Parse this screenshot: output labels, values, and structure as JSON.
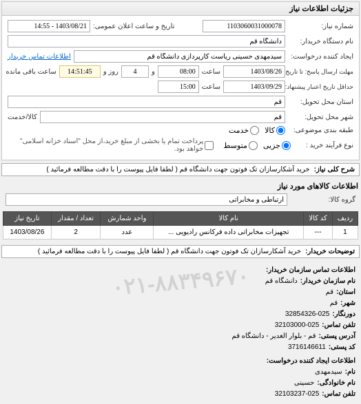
{
  "panel_title": "جزئیات اطلاعات نیاز",
  "fields": {
    "number_label": "شماره نیاز:",
    "number_value": "1103060031000078",
    "announce_label": "تاریخ و ساعت اعلان عمومی:",
    "announce_value": "1403/08/21 - 14:55",
    "device_label": "نام دستگاه خریدار:",
    "device_value": "دانشگاه قم",
    "requester_label": "ایجاد کننده درخواست:",
    "requester_value": "سیدمهدی حسینی ریاست کارپردازی دانشگاه قم",
    "contact_link": "اطلاعات تماس خریدار",
    "response_until_label": "مهلت ارسال پاسخ: تا تاریخ:",
    "response_date": "1403/08/26",
    "response_time_label": "ساعت",
    "response_time": "08:00",
    "and_label": "و",
    "remaining_days": "4",
    "remaining_days_label": "روز و",
    "remaining_time": "14:51:45",
    "remaining_suffix": "ساعت باقی مانده",
    "validity_label": "حداقل تاریخ اعتبار پیشنهاد: تا تاریخ:",
    "validity_date": "1403/09/29",
    "validity_time_label": "ساعت",
    "validity_time": "15:00",
    "province_label": "استان محل تحویل:",
    "province_value": "قم",
    "city_label": "شهر محل تحویل:",
    "city_value": "قم",
    "service_label": "کالا/خدمت",
    "radio_category_label": "طبقه بندی موضوعی:",
    "radio_goods": "کالا",
    "radio_service": "خدمت",
    "radio_type_label": "نوع فرآیند خرید :",
    "radio_partial": "جزیی",
    "radio_medium": "متوسط",
    "payment_note": "پرداخت تمام یا بخشی از مبلغ خرید،از محل \"اسناد خزانه اسلامی\" خواهد بود."
  },
  "description": {
    "label": "شرح کلی نیاز:",
    "value": "خرید آشکارسازان تک فوتون جهت دانشگاه قم ( لطفا فایل پیوست را با دقت مطالعه فرمائید )"
  },
  "goods_section_title": "اطلاعات کالاهای مورد نیاز",
  "group_label": "گروه کالا:",
  "group_value": "ارتباطی و مخابراتی",
  "table": {
    "headers": [
      "ردیف",
      "کد کالا",
      "نام کالا",
      "واحد شمارش",
      "تعداد / مقدار",
      "تاریخ نیاز"
    ],
    "rows": [
      [
        "1",
        "---",
        "تجهیزات مخابراتی داده فرکانس رادیویی ...",
        "عدد",
        "2",
        "1403/08/26"
      ]
    ]
  },
  "buyer_notes": {
    "label": "توضیحات خریدار:",
    "value": "خرید آشکارسازان تک فوتون جهت دانشگاه قم ( لطفا فایل پیوست را با دقت مطالعه فرمائید )"
  },
  "watermark_text": "۰۲۱-۸۸۳۴۹۶۷۰",
  "contact_section_title": "اطلاعات تماس سازمان خریدار:",
  "contact": {
    "org_label": "نام سازمان خریدار:",
    "org_value": "دانشگاه قم",
    "province_label": "استان:",
    "province_value": "قم",
    "city_label": "شهر:",
    "city_value": "قم",
    "fax_label": "دورنگار:",
    "fax_value": "32854326-025",
    "phone_label": "تلفن تماس:",
    "phone_value": "32103000-025",
    "address_label": "آدرس پستی:",
    "address_value": "قم - بلوار الغدیر - دانشگاه قم",
    "postal_label": "کد پستی:",
    "postal_value": "3716146611",
    "creator_section": "اطلاعات ایجاد کننده درخواست:",
    "name_label": "نام:",
    "name_value": "سیدمهدی",
    "lastname_label": "نام خانوادگی:",
    "lastname_value": "حسینی",
    "tel_label": "تلفن تماس:",
    "tel_value": "32103237-025"
  }
}
